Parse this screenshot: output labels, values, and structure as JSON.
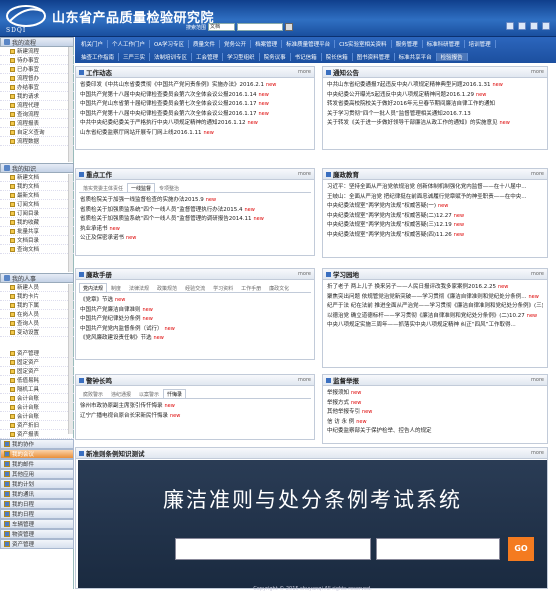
{
  "header": {
    "title": "山东省产品质量检验研究院",
    "logo_text": "SDQI",
    "search_select": "文档",
    "search_scope": "搜索范围"
  },
  "nav": {
    "row1": [
      "机关门户",
      "个人工作门户",
      "OA学习专区",
      "质量文件",
      "党务公开",
      "档案管理",
      "标准质量管理平台",
      "CIS实验室相关资料",
      "服务管理",
      "标准科研管理",
      "培训管理"
    ],
    "row2": [
      "抽查工作指南",
      "三严三实",
      "法制培训专区",
      "工会管理",
      "学习型组织",
      "院务议事",
      "书记信箱",
      "院长信箱",
      "图书资料管理",
      "标准共享平台",
      "检验报告"
    ]
  },
  "left": {
    "workflow": {
      "title": "我的流程",
      "items": [
        "新建流程",
        "待办事宜",
        "已办事宜",
        "流程督办",
        "办结事宜",
        "我的请求",
        "流程代理",
        "查询流程",
        "流程报表",
        "自定义查询",
        "流程数据"
      ]
    },
    "knowledge": {
      "title": "我的知识",
      "items": [
        "新建文档",
        "我的文档",
        "最新文档",
        "订阅文档",
        "订阅目录",
        "我的收藏",
        "批量共享",
        "文档目录",
        "查询文档"
      ]
    },
    "hr": {
      "title": "我的人事",
      "items": [
        "新建人员",
        "我的卡片",
        "我的下属",
        "在岗人员",
        "查询人员",
        "变动设置"
      ]
    },
    "assets": {
      "items": [
        "资产管理",
        "固定资产",
        "固定资产",
        "低值易耗",
        "隔机工具",
        "会计台账",
        "会计台账",
        "会计台账",
        "资产折旧",
        "资产报表"
      ]
    },
    "bottom": [
      "我的协作",
      "我的会议",
      "我的邮件",
      "其他应用",
      "我的计划",
      "我的通讯",
      "我的日程",
      "我的日程",
      "车辆管理",
      "物资管理",
      "资产管理"
    ],
    "bottom_active": "我的会议"
  },
  "panels": {
    "work": {
      "title": "工作动态",
      "more": "more",
      "items": [
        {
          "text": "省委印发《中共山东省委贯彻《中国共产党问责条例》实施办法》2016.2.1",
          "tag": "new"
        },
        {
          "text": "中国共产党第十八届中央纪律检查委员会第六次全体会议公报2016.1.14",
          "tag": "new"
        },
        {
          "text": "中国共产党山东省第十届纪律检查委员会第七次全体会议公报2016.1.17",
          "tag": "new"
        },
        {
          "text": "中国共产党第十八届中央纪律检查委员会第六次全体会议公报2016.1.17",
          "tag": "new"
        },
        {
          "text": "中共中央纪委纪委关于严格执行中央八项规定精神的通知2016.1.12",
          "tag": "new"
        },
        {
          "text": "山东省纪委监察厅网站开展专门网上线2016.1.11",
          "tag": "new"
        }
      ]
    },
    "notice": {
      "title": "通知公告",
      "more": "more",
      "items": [
        {
          "text": "中共山东省纪委通报7起违反中央八项规定精神典型问题2016.1.31",
          "tag": "new"
        },
        {
          "text": "中央纪委公开曝光5起违反中央八项规定精神问题2016.1.29",
          "tag": "new"
        },
        {
          "text": "转发省委高校院校关于做好2016年元旦春节期间廉洁自律工作的通知",
          "tag": ""
        },
        {
          "text": "关于学习贯彻“四个一批人员”监督管理相关通知2016.7.13",
          "tag": ""
        },
        {
          "text": "关于转发《关于进一步做好领导干部廉洁从政工作的通知》的实施意见",
          "tag": "new"
        }
      ]
    },
    "key": {
      "title": "重点工作",
      "more": "more",
      "tabs": [
        "落实党委主体责任",
        "一线监督",
        "专项整治"
      ],
      "active_tab": "一线监督",
      "items": [
        {
          "text": "省质检院关于加强一线监督检查的实施办法2015.9",
          "tag": "new"
        },
        {
          "text": "省质检关于加强质监系统“四个一线人员”监督管理执行办法2015.4",
          "tag": "new"
        },
        {
          "text": "省质检关于加强质监系统“四个一线人员”监督管理的调研报告2014.11",
          "tag": "new"
        },
        {
          "text": "执业承诺书",
          "tag": "new"
        },
        {
          "text": "公正及保密承诺书",
          "tag": "new"
        }
      ]
    },
    "clean": {
      "title": "廉政教育",
      "more": "more",
      "items": [
        {
          "text": "习近平：坚持全面从严治党依规治党 创新体制机制强化党内监督——在十八届中...",
          "tag": ""
        },
        {
          "text": "王岐山：全面从严治党 把纪律挺在前面忠诚履行党章赋予的神圣职责——在中央...",
          "tag": ""
        },
        {
          "text": "中央纪委法规室“两学党内法规”权威答疑(一)",
          "tag": "new"
        },
        {
          "text": "中央纪委法规室“两学党内法规”权威答疑(二)12.27",
          "tag": "new"
        },
        {
          "text": "中央纪委法规室“两学党内法规”权威答疑(三)12.19",
          "tag": "new"
        },
        {
          "text": "中央纪委法规室“两学党内法规”权威答疑(四)11.26",
          "tag": "new"
        }
      ]
    },
    "manual": {
      "title": "廉政手册",
      "more": "more",
      "tabs": [
        "党内法规",
        "制度",
        "法律法规",
        "政策规范",
        "经验交流",
        "学习资料",
        "工作手册",
        "廉政文化"
      ],
      "active_tab": "党内法规",
      "items": [
        {
          "text": "《党章》节选",
          "tag": "new"
        },
        {
          "text": "中国共产党廉洁自律准则",
          "tag": "new"
        },
        {
          "text": "中国共产党纪律处分条例",
          "tag": "new"
        },
        {
          "text": "中国共产党党内监督条例（试行）",
          "tag": "new"
        },
        {
          "text": "《党风廉政建设责任制》节选",
          "tag": "new"
        }
      ]
    },
    "study": {
      "title": "学习园地",
      "more": "more",
      "items": [
        {
          "text": "折了老子 两上儿子 换来另子——人民日报评改我多家案例2016.2.25",
          "tag": "new"
        },
        {
          "text": "聚焦突出问题 依规管党治党新突破——学习贯彻《廉洁自律准则和党纪处分条例...",
          "tag": "new"
        },
        {
          "text": "纪严于法 纪在法前 推进全面从严治党——学习贯彻《廉洁自律准则和党纪处分条例》(三)10.27",
          "tag": "new"
        },
        {
          "text": "以德治党 确立道德标杆——学习贯彻《廉洁自律准则和党纪处分条例》(二)10.27",
          "tag": "new"
        },
        {
          "text": "中央八项规定实施三周年——抓落实中央八项规定精神 纠正“四风”工作取得...",
          "tag": ""
        }
      ]
    },
    "warn": {
      "title": "警钟长鸣",
      "more": "more",
      "tabs": [
        "腐败警示",
        "违纪通报",
        "以案警示",
        "忏悔录"
      ],
      "active_tab": "忏悔录",
      "items": [
        {
          "text": "徐州市政协原副主席张引传忏悔录",
          "tag": "new"
        },
        {
          "text": "辽宁广播电视台原台长宋新民忏悔录",
          "tag": "new"
        }
      ]
    },
    "supervise": {
      "title": "监督举报",
      "more": "more",
      "items": [
        {
          "text": "举报须知",
          "tag": "new"
        },
        {
          "text": "举报方式",
          "tag": "new"
        },
        {
          "text": "其他举报专引",
          "tag": "new"
        },
        {
          "text": "信 访 永 例",
          "tag": "new"
        },
        {
          "text": "中纪委监察部关于保护检举、控告人的规定",
          "tag": ""
        }
      ]
    }
  },
  "exam": {
    "section_title": "新准则条例知识测试",
    "more": "more",
    "title": "廉洁准则与处分条例考试系统",
    "go": "GO",
    "copyright": "Copyright © 2015 shuyanqi All rights reserved."
  }
}
